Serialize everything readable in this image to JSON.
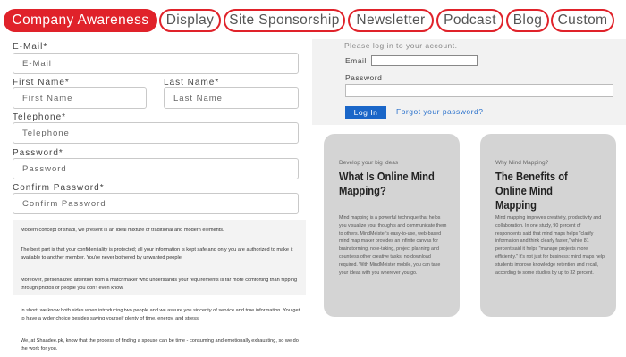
{
  "tabs": [
    {
      "label": "Company Awareness",
      "active": true
    },
    {
      "label": "Display",
      "active": false
    },
    {
      "label": "Site Sponsorship",
      "active": false
    },
    {
      "label": "Newsletter",
      "active": false
    },
    {
      "label": "Podcast",
      "active": false
    },
    {
      "label": "Blog",
      "active": false
    },
    {
      "label": "Custom",
      "active": false
    }
  ],
  "signup": {
    "email_label": "E-Mail*",
    "email_placeholder": "E-Mail",
    "first_name_label": "First Name*",
    "first_name_placeholder": "First Name",
    "last_name_label": "Last Name*",
    "last_name_placeholder": "Last Name",
    "telephone_label": "Telephone*",
    "telephone_placeholder": "Telephone",
    "password_label": "Password*",
    "password_placeholder": "Password",
    "confirm_label": "Confirm Password*",
    "confirm_placeholder": "Confirm Password"
  },
  "description": {
    "p1": "Modern concept of shadi, we present is an ideal mixture of traditional and modern elements.",
    "p2": "The best part is that your confidentiality is protected; all your information is kept safe and only you are authorized to make it available to another member. You're never bothered by unwanted people.",
    "p3": "Moreover, personalized attention from a matchmaker who understands your requirements is far more comforting than flipping through photos of people you don't even know.",
    "p4": "In short, we know both sides when introducing two people and we assure you sincerity of service and true information. You get to have a wider choice besides saving yourself plenty of time, energy, and stress.",
    "p5": "We, at Shaadee.pk, know that the process of finding a spouse can be time - consuming and emotionally exhausting, so we do the work for you."
  },
  "login": {
    "message": "Please log in to your account.",
    "email_label": "Email",
    "password_label": "Password",
    "button": "Log In",
    "forgot": "Forgot your password?"
  },
  "cards": [
    {
      "kicker": "Develop your big ideas",
      "title": "What Is Online Mind Mapping?",
      "body": "Mind mapping is a powerful technique that helps you visualize your thoughts and communicate them to others. MindMeister's easy-to-use, web-based mind map maker provides an infinite canvas for brainstorming, note-taking, project planning and countless other creative tasks, no download required. With MindMeister mobile, you can take your ideas with you wherever you go."
    },
    {
      "kicker": "Why Mind Mapping?",
      "title": "The Benefits of Online Mind Mapping",
      "body": "Mind mapping improves creativity, productivity and collaboration. In one study, 90 percent of respondents said that mind maps helps \"clarify information and think clearly faster,\" while 81 percent said it helps \"manage projects more efficiently.\" It's not just for business: mind maps help students improve knowledge retention and recall, according to some studies by up to 32 percent."
    }
  ],
  "colors": {
    "tab_accent": "#e0222a",
    "login_button": "#1a66c8",
    "card_bg": "#d4d4d4"
  }
}
